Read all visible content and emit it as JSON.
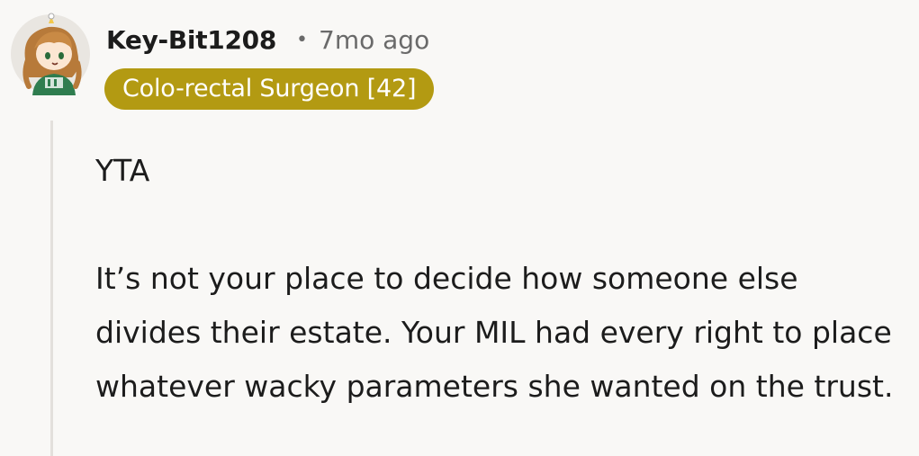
{
  "comment": {
    "author": "Key-Bit1208",
    "separator": "•",
    "timestamp": "7mo ago",
    "flair": "Colo-rectal Surgeon [42]",
    "avatar_icon": "cartoon-avatar-icon",
    "paragraphs": [
      "YTA",
      "It’s not your place to decide how someone else divides their estate. Your MIL had every right to place whatever wacky parameters she wanted on the trust."
    ]
  },
  "colors": {
    "background": "#f9f8f6",
    "flair_bg": "#b39a12",
    "text": "#1c1c1c",
    "meta_text": "#6a6a6a"
  }
}
